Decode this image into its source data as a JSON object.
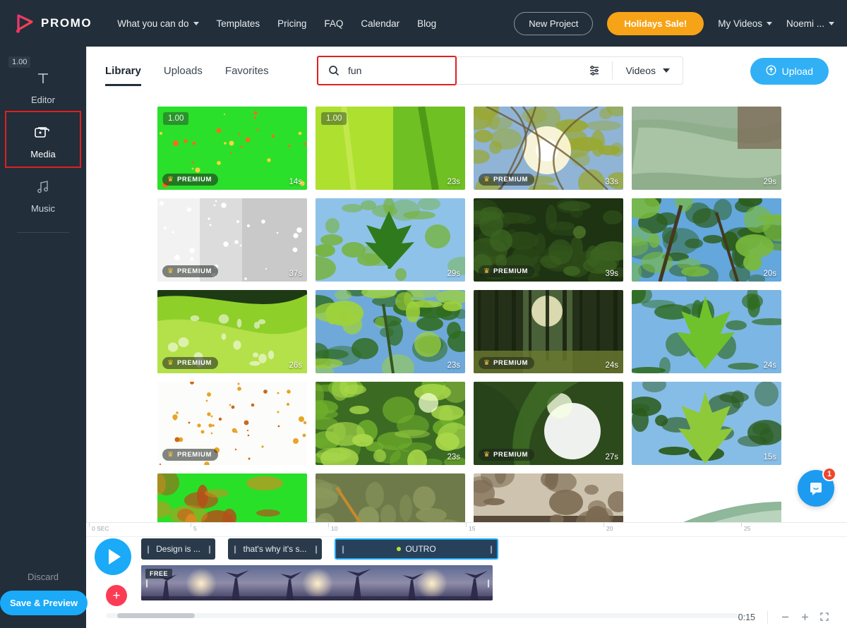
{
  "brand": {
    "name": "PROMO",
    "logo_icon": "promo-play-logo"
  },
  "topnav": {
    "links": [
      {
        "label": "What you can do",
        "has_caret": true
      },
      {
        "label": "Templates",
        "has_caret": false
      },
      {
        "label": "Pricing",
        "has_caret": false
      },
      {
        "label": "FAQ",
        "has_caret": false
      },
      {
        "label": "Calendar",
        "has_caret": false
      },
      {
        "label": "Blog",
        "has_caret": false
      }
    ],
    "new_project": "New Project",
    "sale": "Holidays Sale!",
    "my_videos": "My Videos",
    "account": "Noemi ...",
    "sale_color": "#f7a317"
  },
  "sidebar": {
    "badge": "1.00",
    "items": [
      {
        "label": "Editor",
        "icon": "text-T-icon",
        "active": false,
        "highlighted": false
      },
      {
        "label": "Media",
        "icon": "media-stack-icon",
        "active": true,
        "highlighted": true
      },
      {
        "label": "Music",
        "icon": "music-note-icon",
        "active": false,
        "highlighted": false
      }
    ],
    "discard": "Discard",
    "save_preview": "Save & Preview",
    "highlight_color": "#e02020",
    "save_color": "#1aaaf8"
  },
  "library": {
    "tabs": [
      {
        "label": "Library",
        "active": true
      },
      {
        "label": "Uploads",
        "active": false
      },
      {
        "label": "Favorites",
        "active": false
      }
    ],
    "search": {
      "value": "fun",
      "placeholder": "Search",
      "icon": "search-icon",
      "highlighted": true
    },
    "filter_icon": "sliders-filter-icon",
    "type_select": {
      "value": "Videos",
      "icon": "chevron-down-icon"
    },
    "upload_button": {
      "label": "Upload",
      "icon": "upload-circle-icon",
      "color": "#32b0f5"
    }
  },
  "media_grid": {
    "premium_label": "PREMIUM",
    "items": [
      {
        "duration": "14s",
        "premium": true,
        "badge": "1.00",
        "style": "greenscreen-confetti"
      },
      {
        "duration": "23s",
        "premium": false,
        "badge": "1.00",
        "style": "leaf-closeup-bright"
      },
      {
        "duration": "33s",
        "premium": true,
        "badge": "",
        "style": "sun-through-branches"
      },
      {
        "duration": "29s",
        "premium": false,
        "badge": "",
        "style": "dewy-leaf-pale"
      },
      {
        "duration": "37s",
        "premium": true,
        "badge": "",
        "style": "white-snow-fog"
      },
      {
        "duration": "29s",
        "premium": false,
        "badge": "",
        "style": "maple-leaf-sky"
      },
      {
        "duration": "39s",
        "premium": true,
        "badge": "",
        "style": "dark-foliage"
      },
      {
        "duration": "20s",
        "premium": false,
        "badge": "",
        "style": "canopy-blue-sky"
      },
      {
        "duration": "26s",
        "premium": true,
        "badge": "",
        "style": "waterdrops-leaf"
      },
      {
        "duration": "23s",
        "premium": false,
        "badge": "",
        "style": "backlit-leaves"
      },
      {
        "duration": "24s",
        "premium": true,
        "badge": "",
        "style": "forest-sunbeam"
      },
      {
        "duration": "24s",
        "premium": false,
        "badge": "",
        "style": "green-maple-sky"
      },
      {
        "duration": "",
        "premium": true,
        "badge": "",
        "style": "white-falling-leaves"
      },
      {
        "duration": "23s",
        "premium": false,
        "badge": "",
        "style": "sunlit-green-leaves"
      },
      {
        "duration": "27s",
        "premium": true,
        "badge": "",
        "style": "sunflare-leaf"
      },
      {
        "duration": "15s",
        "premium": false,
        "badge": "",
        "style": "oak-leaf-sky"
      },
      {
        "duration": "",
        "premium": false,
        "badge": "",
        "style": "greenscreen-leaves"
      },
      {
        "duration": "",
        "premium": false,
        "badge": "",
        "style": "autumn-orange-leaf"
      },
      {
        "duration": "",
        "premium": false,
        "badge": "",
        "style": "soil-macro"
      },
      {
        "duration": "",
        "premium": false,
        "badge": "",
        "style": "aloe-white"
      }
    ]
  },
  "timeline": {
    "ruler": [
      "0 SEC",
      "5",
      "10",
      "15",
      "20",
      "25"
    ],
    "play_icon": "play-icon",
    "add_icon": "plus-icon",
    "text_clips": [
      {
        "label": "Design is ...",
        "selected": false
      },
      {
        "label": "that's why it's s...",
        "selected": false
      },
      {
        "label": "OUTRO",
        "selected": true,
        "dot": true
      }
    ],
    "video_clip": {
      "badge": "FREE",
      "style": "palm-sunset"
    },
    "total_time": "0:15",
    "zoom_out_icon": "minus-icon",
    "zoom_in_icon": "plus-icon",
    "fit_icon": "fit-screen-icon"
  },
  "chat": {
    "icon": "chat-bubble-icon",
    "badge": "1",
    "color": "#1d9bf0"
  }
}
